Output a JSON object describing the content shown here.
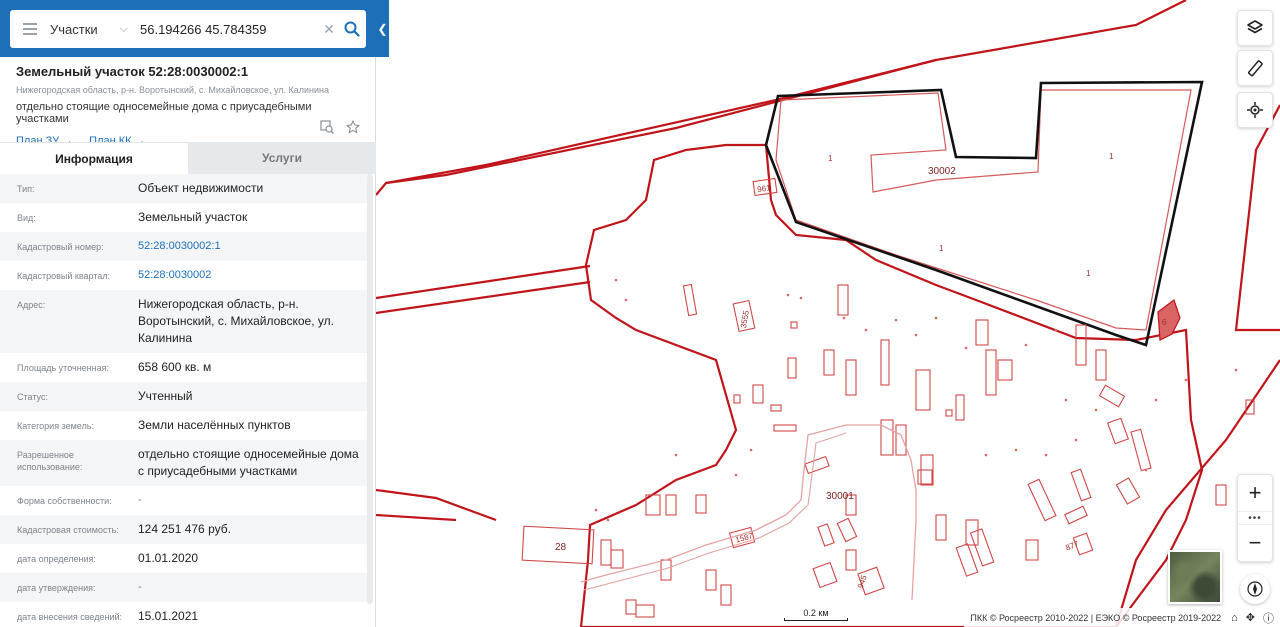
{
  "search": {
    "layer": "Участки",
    "query": "56.194266 45.784359"
  },
  "object": {
    "title": "Земельный участок 52:28:0030002:1",
    "address": "Нижегородская область, р-н. Воротынский, с. Михайловское, ул. Калинина",
    "use": "отдельно стоящие односемейные дома с приусадебными участками",
    "links": [
      "План ЗУ",
      "План КК"
    ]
  },
  "tabs": [
    {
      "label": "Информация",
      "active": true
    },
    {
      "label": "Услуги",
      "active": false
    }
  ],
  "info": [
    {
      "key": "Тип:",
      "value": "Объект недвижимости"
    },
    {
      "key": "Вид:",
      "value": "Земельный участок"
    },
    {
      "key": "Кадастровый номер:",
      "value": "52:28:0030002:1",
      "link": true
    },
    {
      "key": "Кадастровый квартал:",
      "value": "52:28:0030002",
      "link": true
    },
    {
      "key": "Адрес:",
      "value": "Нижегородская область, р-н. Воротынский, с. Михайловское, ул. Калинина"
    },
    {
      "key": "Площадь уточненная:",
      "value": "658 600 кв. м"
    },
    {
      "key": "Статус:",
      "value": "Учтенный"
    },
    {
      "key": "Категория земель:",
      "value": "Земли населённых пунктов"
    },
    {
      "key": "Разрешенное использование:",
      "value": "отдельно стоящие односемейные дома с приусадебными участками"
    },
    {
      "key": "Форма собственности:",
      "value": "-"
    },
    {
      "key": "Кадастровая стоимость:",
      "value": "124 251 476 руб."
    },
    {
      "key": "дата определения:",
      "value": "01.01.2020"
    },
    {
      "key": "дата утверждения:",
      "value": "-"
    },
    {
      "key": "дата внесения сведений:",
      "value": "15.01.2021"
    }
  ],
  "map": {
    "labels": {
      "quarter_main": "30002",
      "quarter_village": "30001",
      "p961": "961",
      "p3555": "3555",
      "p28": "28",
      "p1587": "1587",
      "p877": "877",
      "p945": "945",
      "p6": "6",
      "one": "1"
    },
    "scale": "0.2 км",
    "attribution": "ПКК © Росреестр 2010-2022 | ЕЭКО © Росреестр 2019-2022",
    "colors": {
      "boundary": "#c0141a",
      "selected": "#111111",
      "parcel": "#d04848"
    }
  }
}
